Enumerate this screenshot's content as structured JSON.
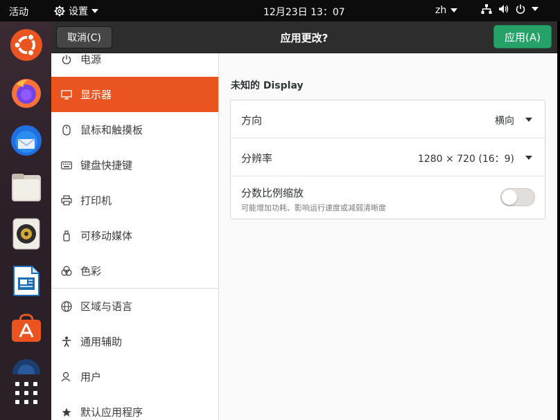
{
  "topbar": {
    "activities": "活动",
    "app_menu_label": "设置",
    "clock": "12月23日  13：07",
    "input_method": "zh",
    "tray_icons": [
      "network-icon",
      "volume-icon",
      "power-icon"
    ]
  },
  "dock": {
    "apps": [
      {
        "name": "ubuntu-icon",
        "running": false
      },
      {
        "name": "firefox-icon",
        "running": false
      },
      {
        "name": "thunderbird-icon",
        "running": false
      },
      {
        "name": "files-icon",
        "running": false
      },
      {
        "name": "rhythmbox-icon",
        "running": false
      },
      {
        "name": "libreoffice-writer-icon",
        "running": false
      },
      {
        "name": "software-icon",
        "running": false
      },
      {
        "name": "help-icon",
        "running": false
      },
      {
        "name": "show-apps-icon",
        "running": false
      }
    ]
  },
  "header": {
    "cancel_label": "取消(C)",
    "title": "应用更改?",
    "apply_label": "应用(A)"
  },
  "sidebar": {
    "items": [
      {
        "label": "电源",
        "icon": "power-icon"
      },
      {
        "label": "显示器",
        "icon": "display-icon",
        "active": true
      },
      {
        "label": "鼠标和触摸板",
        "icon": "mouse-icon"
      },
      {
        "label": "键盘快捷键",
        "icon": "keyboard-icon"
      },
      {
        "label": "打印机",
        "icon": "printer-icon"
      },
      {
        "label": "可移动媒体",
        "icon": "removable-media-icon"
      },
      {
        "label": "色彩",
        "icon": "color-icon"
      },
      {
        "label": "区域与语言",
        "icon": "globe-icon"
      },
      {
        "label": "通用辅助",
        "icon": "accessibility-icon"
      },
      {
        "label": "用户",
        "icon": "users-icon"
      },
      {
        "label": "默认应用程序",
        "icon": "star-icon"
      }
    ]
  },
  "display": {
    "section_title": "未知的 Display",
    "orientation_label": "方向",
    "orientation_value": "横向",
    "resolution_label": "分辨率",
    "resolution_value": "1280 × 720 (16：9)",
    "fractional_label": "分数比例缩放",
    "fractional_sub": "可能增加功耗、影响运行速度或减弱清晰度",
    "fractional_enabled": false
  },
  "colors": {
    "accent": "#e95420",
    "apply_green": "#26a269",
    "header_bg": "#2d2d2d",
    "topbar_bg": "#0c0c0c"
  }
}
